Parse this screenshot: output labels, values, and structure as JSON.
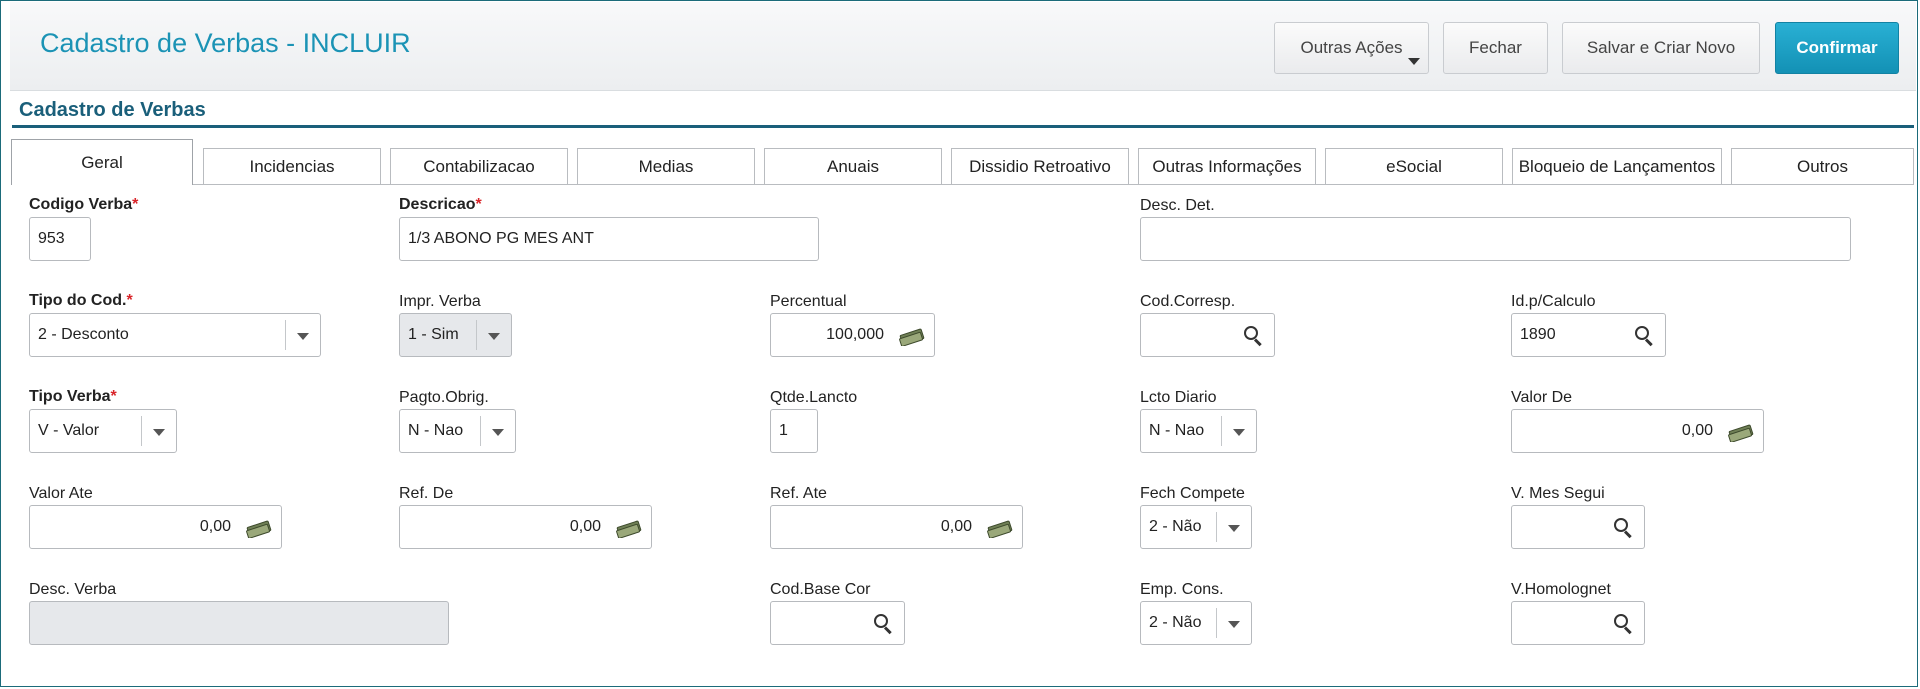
{
  "header": {
    "title": "Cadastro de Verbas - INCLUIR",
    "buttons": {
      "outras_acoes": "Outras Ações",
      "fechar": "Fechar",
      "salvar_criar_novo": "Salvar e Criar Novo",
      "confirmar": "Confirmar"
    }
  },
  "section_title": "Cadastro de Verbas",
  "tabs": [
    "Geral",
    "Incidencias",
    "Contabilizacao",
    "Medias",
    "Anuais",
    "Dissidio Retroativo",
    "Outras Informações",
    "eSocial",
    "Bloqueio de Lançamentos",
    "Outros"
  ],
  "active_tab": "Geral",
  "required_mark": "*",
  "fields": {
    "codigo_verba": {
      "label": "Codigo Verba",
      "value": "953"
    },
    "descricao": {
      "label": "Descricao",
      "value": "1/3 ABONO PG MES ANT"
    },
    "desc_det": {
      "label": "Desc. Det.",
      "value": ""
    },
    "tipo_cod": {
      "label": "Tipo do Cod.",
      "value": "2 - Desconto"
    },
    "impr_verba": {
      "label": "Impr. Verba",
      "value": "1 - Sim"
    },
    "percentual": {
      "label": "Percentual",
      "value": "100,000"
    },
    "cod_corresp": {
      "label": "Cod.Corresp.",
      "value": ""
    },
    "id_calculo": {
      "label": "Id.p/Calculo",
      "value": "1890"
    },
    "tipo_verba": {
      "label": "Tipo Verba",
      "value": "V - Valor"
    },
    "pagto_obrig": {
      "label": "Pagto.Obrig.",
      "value": "N - Nao"
    },
    "qtde_lancto": {
      "label": "Qtde.Lancto",
      "value": "1"
    },
    "lcto_diario": {
      "label": "Lcto Diario",
      "value": "N - Nao"
    },
    "valor_de": {
      "label": "Valor De",
      "value": "0,00"
    },
    "valor_ate": {
      "label": "Valor Ate",
      "value": "0,00"
    },
    "ref_de": {
      "label": "Ref. De",
      "value": "0,00"
    },
    "ref_ate": {
      "label": "Ref. Ate",
      "value": "0,00"
    },
    "fech_compete": {
      "label": "Fech Compete",
      "value": "2 - Não"
    },
    "v_mes_segui": {
      "label": "V. Mes Segui",
      "value": ""
    },
    "desc_verba": {
      "label": "Desc. Verba",
      "value": ""
    },
    "cod_base_cor": {
      "label": "Cod.Base Cor",
      "value": ""
    },
    "emp_cons": {
      "label": "Emp. Cons.",
      "value": "2 - Não"
    },
    "v_homolognet": {
      "label": "V.Homolognet",
      "value": ""
    }
  },
  "icons": {
    "search": "search-icon",
    "money": "money-icon",
    "dropdown": "chevron-down-icon"
  },
  "colors": {
    "title": "#1b93b5",
    "section": "#1a5f7a",
    "primary_button": "#1391b5",
    "required": "#d9252a"
  }
}
